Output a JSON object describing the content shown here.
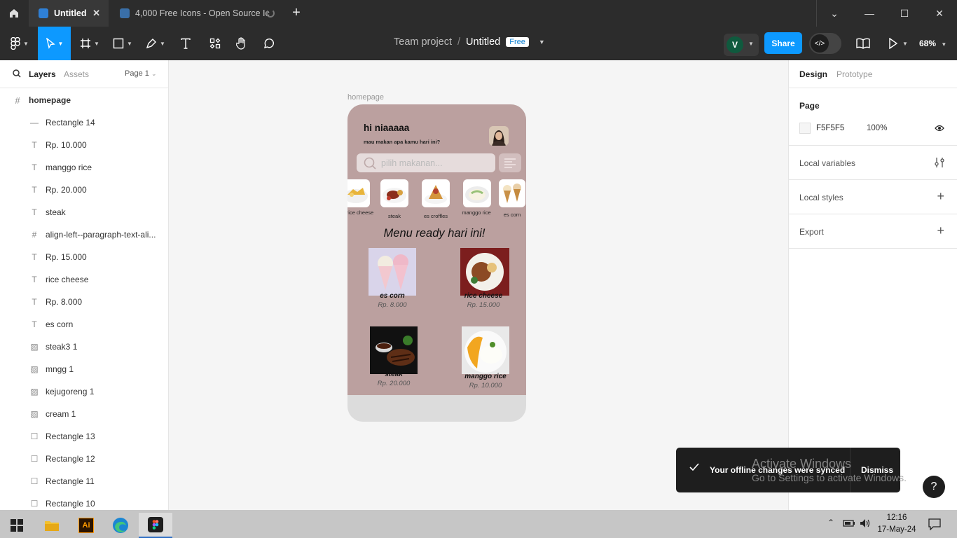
{
  "tabs": {
    "active_title": "Untitled",
    "inactive_title": "4,000 Free Icons - Open Source Ic"
  },
  "toolbar": {
    "project": "Team project",
    "separator": "/",
    "file": "Untitled",
    "plan_badge": "Free",
    "avatar_initial": "V",
    "share": "Share",
    "zoom": "68%"
  },
  "left_panel": {
    "tab_layers": "Layers",
    "tab_assets": "Assets",
    "page_select": "Page 1",
    "frame": "homepage",
    "layers": [
      {
        "icon": "line-icon",
        "name": "Rectangle 14"
      },
      {
        "icon": "text-icon",
        "name": "Rp. 10.000"
      },
      {
        "icon": "text-icon",
        "name": "manggo rice"
      },
      {
        "icon": "text-icon",
        "name": "Rp. 20.000"
      },
      {
        "icon": "text-icon",
        "name": "steak"
      },
      {
        "icon": "frame-icon",
        "name": "align-left--paragraph-text-ali..."
      },
      {
        "icon": "text-icon",
        "name": "Rp. 15.000"
      },
      {
        "icon": "text-icon",
        "name": "rice cheese"
      },
      {
        "icon": "text-icon",
        "name": "Rp. 8.000"
      },
      {
        "icon": "text-icon",
        "name": "es corn"
      },
      {
        "icon": "image-icon",
        "name": "steak3 1"
      },
      {
        "icon": "image-icon",
        "name": "mngg 1"
      },
      {
        "icon": "image-icon",
        "name": "kejugoreng 1"
      },
      {
        "icon": "image-icon",
        "name": "cream 1"
      },
      {
        "icon": "rect-icon",
        "name": "Rectangle 13"
      },
      {
        "icon": "rect-icon",
        "name": "Rectangle 12"
      },
      {
        "icon": "rect-icon",
        "name": "Rectangle 11"
      },
      {
        "icon": "rect-icon",
        "name": "Rectangle 10"
      }
    ]
  },
  "canvas": {
    "frame_label": "homepage",
    "greeting": "hi niaaaaa",
    "subgreeting": "mau makan apa kamu hari ini?",
    "search_placeholder": "pilih makanan...",
    "categories": [
      "rice cheese",
      "steak",
      "es croffles",
      "manggo rice",
      "es corn"
    ],
    "menu_title": "Menu ready hari ini!",
    "foods": [
      {
        "name": "es corn",
        "price": "Rp. 8.000"
      },
      {
        "name": "rice cheese",
        "price": "Rp. 15.000"
      },
      {
        "name": "steak",
        "price": "Rp. 20.000"
      },
      {
        "name": "manggo rice",
        "price": "Rp. 10.000"
      }
    ]
  },
  "right_panel": {
    "tab_design": "Design",
    "tab_prototype": "Prototype",
    "page_heading": "Page",
    "page_color": "F5F5F5",
    "page_opacity": "100%",
    "local_variables": "Local variables",
    "local_styles": "Local styles",
    "export": "Export"
  },
  "toast": {
    "message": "Your offline changes were synced",
    "dismiss": "Dismiss"
  },
  "watermark": {
    "line1": "Activate Windows",
    "line2": "Go to Settings to activate Windows."
  },
  "help": "?",
  "taskbar": {
    "time": "12:16",
    "date": "17-May-24"
  },
  "colors": {
    "accent": "#0d99ff",
    "frame_bg": "#bba09f",
    "chrome": "#2c2c2c"
  }
}
